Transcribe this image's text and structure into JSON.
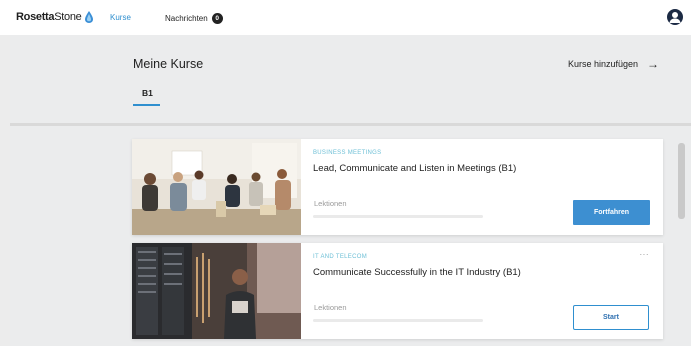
{
  "app": {
    "logo_text_bold": "Rosetta",
    "logo_text": "Stone",
    "brand_color": "#2f8fcf"
  },
  "nav": {
    "courses_label": "Kurse",
    "messages_label": "Nachrichten",
    "messages_count": "0"
  },
  "header": {
    "title": "Meine Kurse",
    "add_courses_label": "Kurse hinzufügen",
    "add_courses_arrow": "→",
    "tabs": [
      {
        "label": "B1",
        "active": true
      }
    ]
  },
  "courses": [
    {
      "category": "BUSINESS MEETINGS",
      "title": "Lead, Communicate and Listen in Meetings (B1)",
      "lessons_label": "Lektionen",
      "progress": 0,
      "action_label": "Fortfahren",
      "image_icon": "meeting-photo"
    },
    {
      "category": "IT AND TELECOM",
      "title": "Communicate Successfully in the IT Industry (B1)",
      "lessons_label": "Lektionen",
      "progress": 0,
      "action_label": "Start",
      "more_label": "···",
      "image_icon": "server-room-photo"
    }
  ]
}
